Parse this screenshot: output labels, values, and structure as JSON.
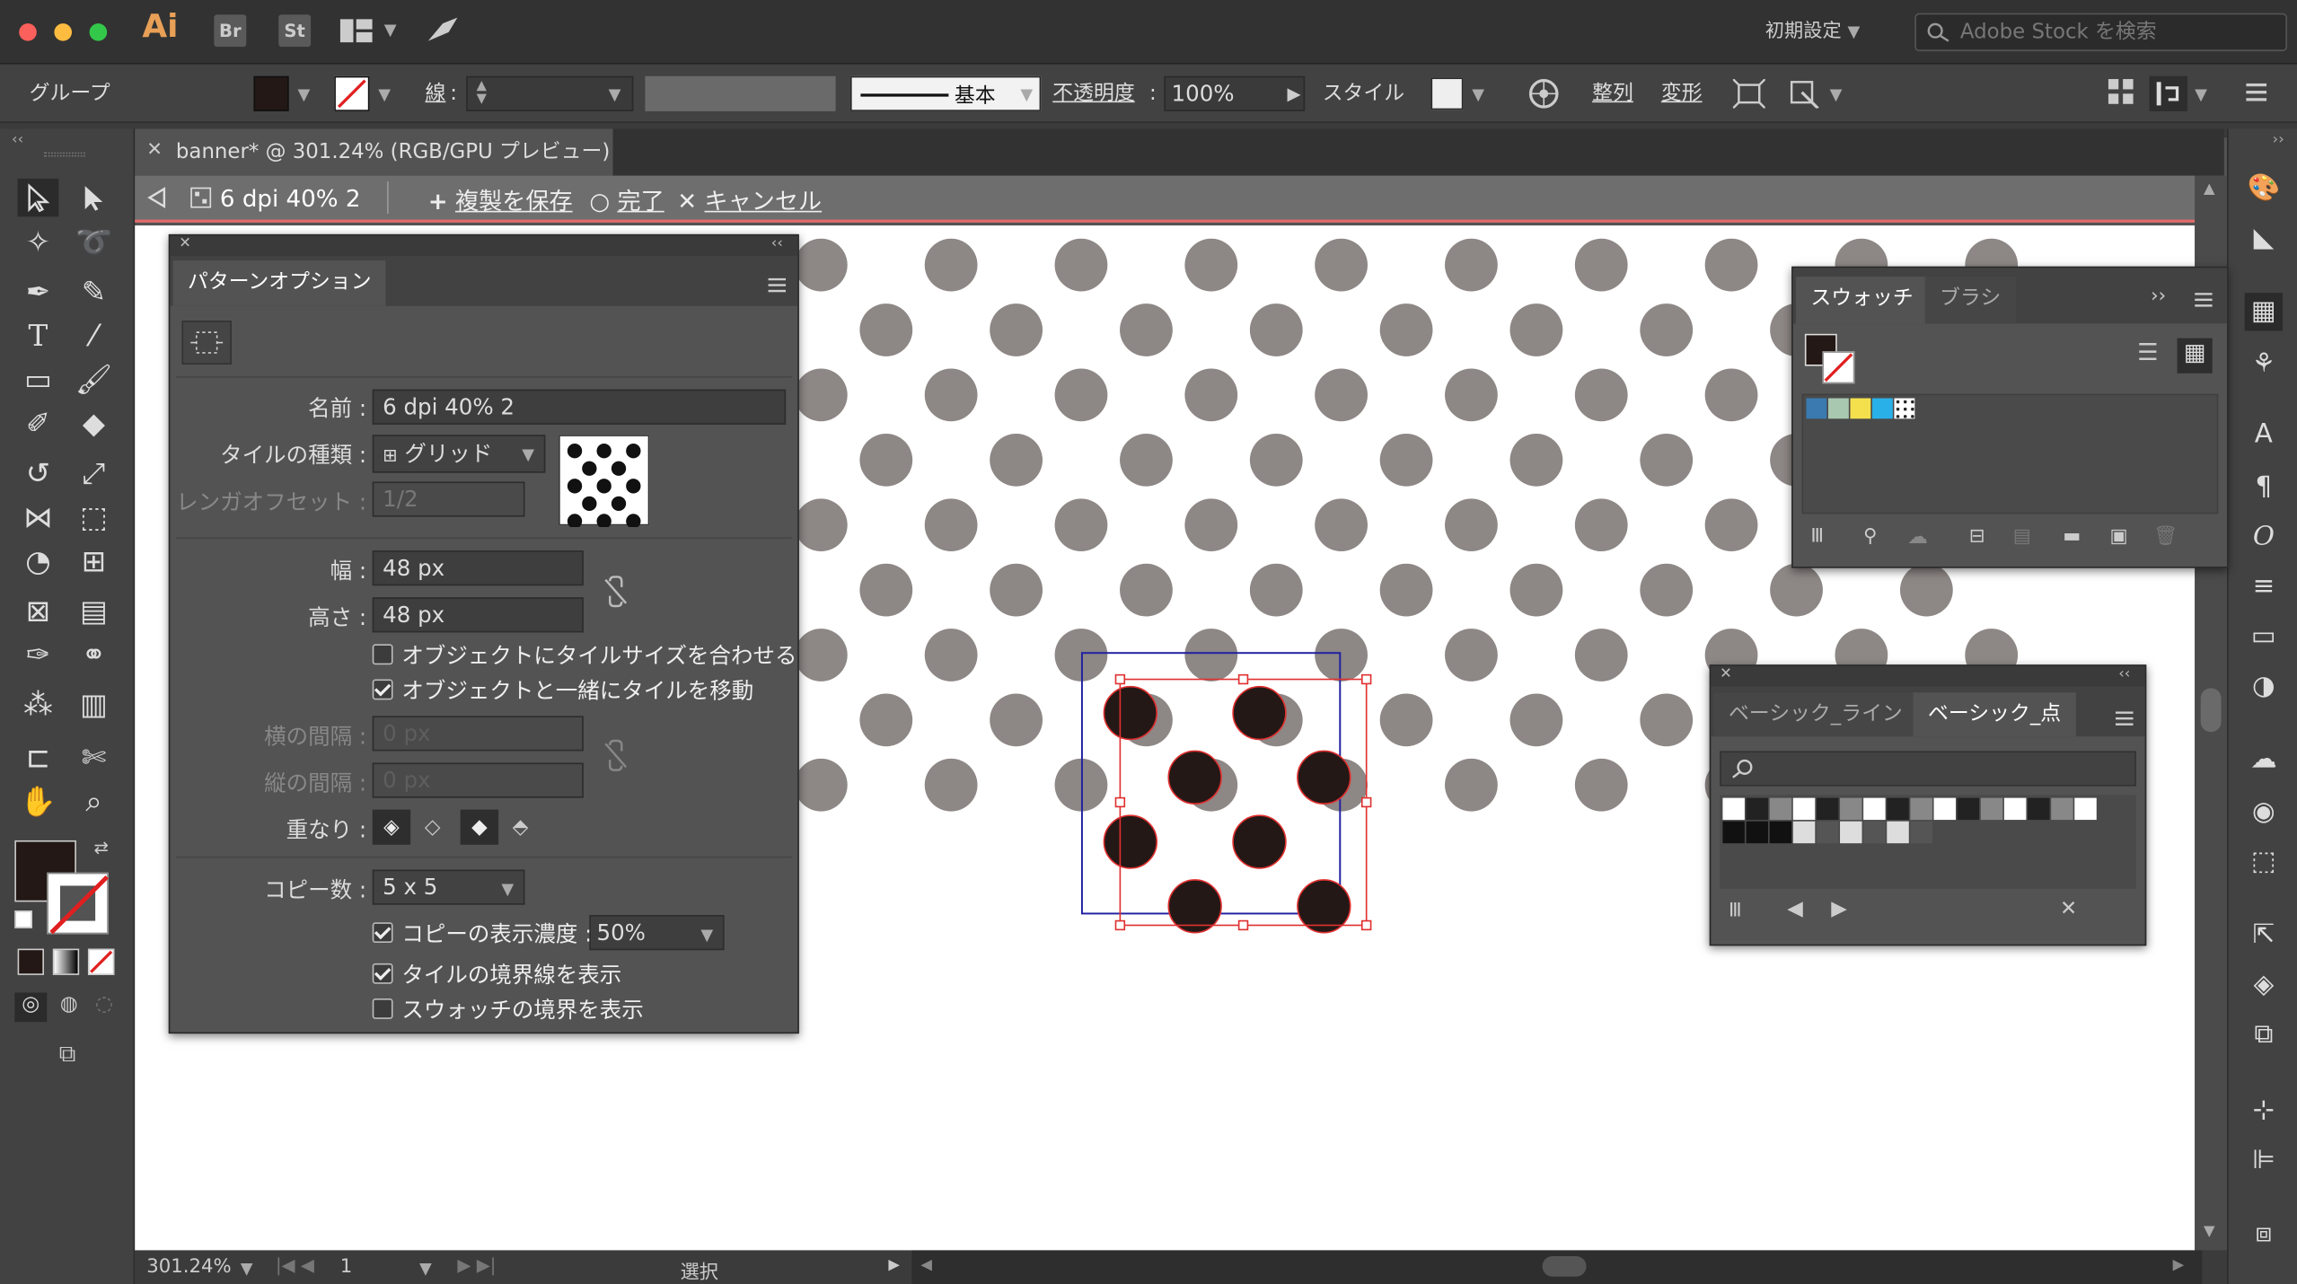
{
  "app": {
    "logo": "Ai",
    "badge_br": "Br",
    "badge_st": "St",
    "workspace": "初期設定",
    "stock_placeholder": "Adobe Stock を検索"
  },
  "control": {
    "selection": "グループ",
    "stroke_label": "線",
    "brush_label": "基本",
    "opacity_label": "不透明度",
    "opacity_value": "100%",
    "style_label": "スタイル",
    "align": "整列",
    "transform": "変形",
    "fill_color": "#231815"
  },
  "document_tab": {
    "title": "banner* @ 301.24% (RGB/GPU プレビュー)"
  },
  "isolation": {
    "pattern_name": "6 dpi 40% 2",
    "save_copy": "複製を保存",
    "done": "完了",
    "cancel": "キャンセル"
  },
  "pattern_options": {
    "tab": "パターンオプション",
    "name_label": "名前",
    "name_value": "6 dpi 40% 2",
    "tile_type_label": "タイルの種類",
    "tile_type_value": "グリッド",
    "brick_offset_label": "レンガオフセット",
    "brick_offset_value": "1/2",
    "width_label": "幅",
    "width_value": "48 px",
    "height_label": "高さ",
    "height_value": "48 px",
    "fit_tile": "オブジェクトにタイルサイズを合わせる",
    "move_tile": "オブジェクトと一緒にタイルを移動",
    "h_spacing_label": "横の間隔",
    "h_spacing_value": "0 px",
    "v_spacing_label": "縦の間隔",
    "v_spacing_value": "0 px",
    "overlap_label": "重なり",
    "copies_label": "コピー数",
    "copies_value": "5 x 5",
    "dim_copies": "コピーの表示濃度",
    "dim_value": "50%",
    "show_tile_edge": "タイルの境界線を表示",
    "show_swatch_bounds": "スウォッチの境界を表示",
    "fit_tile_checked": false,
    "move_tile_checked": true,
    "dim_checked": true,
    "tile_edge_checked": true,
    "swatch_bounds_checked": false
  },
  "swatches_panel": {
    "tab1": "スウォッチ",
    "tab2": "ブラシ",
    "colors": [
      "#3a7ab0",
      "#a8c8b0",
      "#f4e04d",
      "#2ab0e8"
    ]
  },
  "library_panel": {
    "tab1": "ベーシック_ライン",
    "tab2": "ベーシック_点"
  },
  "status": {
    "zoom": "301.24%",
    "page": "1",
    "mode": "選択"
  }
}
